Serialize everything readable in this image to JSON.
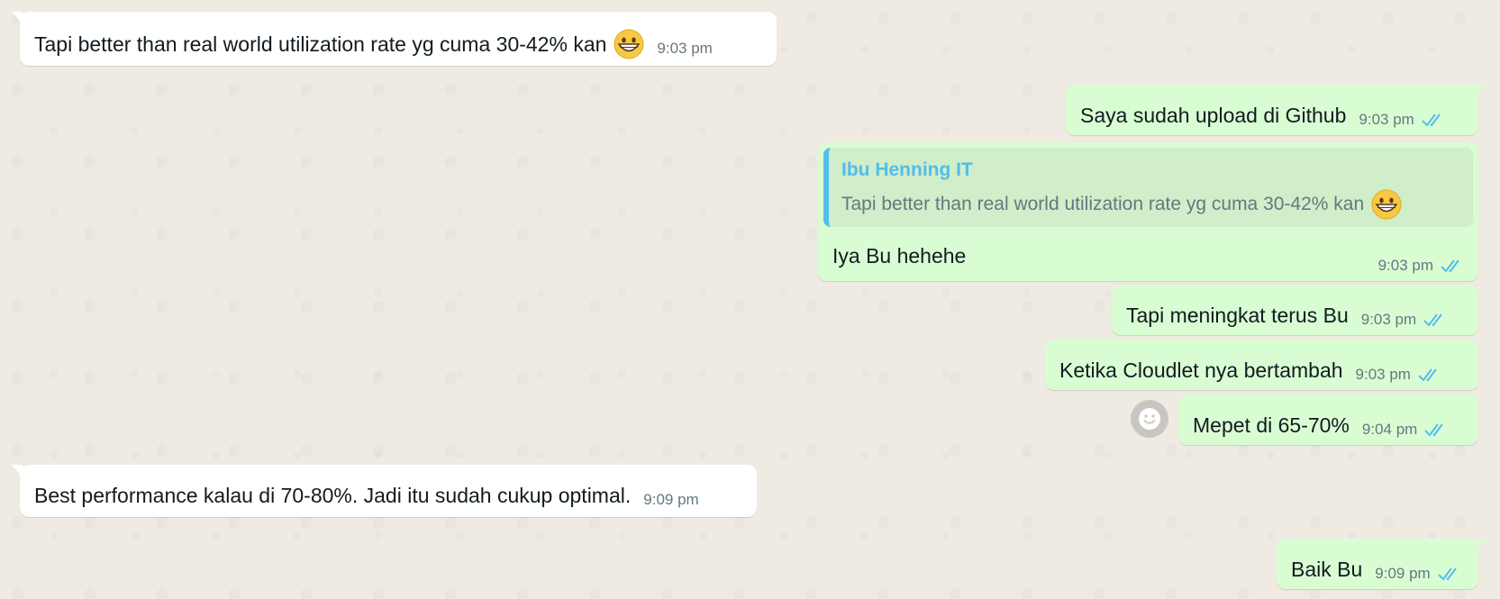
{
  "messages": [
    {
      "direction": "in",
      "text": "Tapi better than real world utilization rate yg cuma 30-42% kan",
      "emoji": "grinning-face-with-big-eyes",
      "time": "9:03 pm"
    },
    {
      "direction": "out",
      "text": "Saya sudah upload di Github",
      "time": "9:03 pm",
      "status": "read"
    },
    {
      "direction": "out",
      "quote": {
        "author": "Ibu Henning IT",
        "text": "Tapi better than real world utilization rate yg cuma 30-42% kan",
        "emoji": "grinning-face-with-big-eyes"
      },
      "text": "Iya Bu hehehe",
      "time": "9:03 pm",
      "status": "read"
    },
    {
      "direction": "out",
      "text": "Tapi meningkat terus Bu",
      "time": "9:03 pm",
      "status": "read"
    },
    {
      "direction": "out",
      "text": "Ketika Cloudlet nya bertambah",
      "time": "9:03 pm",
      "status": "read"
    },
    {
      "direction": "out",
      "text": "Mepet di 65-70%",
      "time": "9:04 pm",
      "status": "read",
      "react_icon": "smiley-icon"
    },
    {
      "direction": "in",
      "text": "Best performance kalau di 70-80%. Jadi itu sudah cukup optimal.",
      "time": "9:09 pm"
    },
    {
      "direction": "out",
      "text": "Baik Bu",
      "time": "9:09 pm",
      "status": "read"
    }
  ],
  "colors": {
    "background": "#efeae2",
    "incoming_bubble": "#ffffff",
    "outgoing_bubble": "#d9fdd3",
    "read_ticks": "#53bdeb",
    "quote_author": "#53bdeb",
    "timestamp": "#667781"
  }
}
